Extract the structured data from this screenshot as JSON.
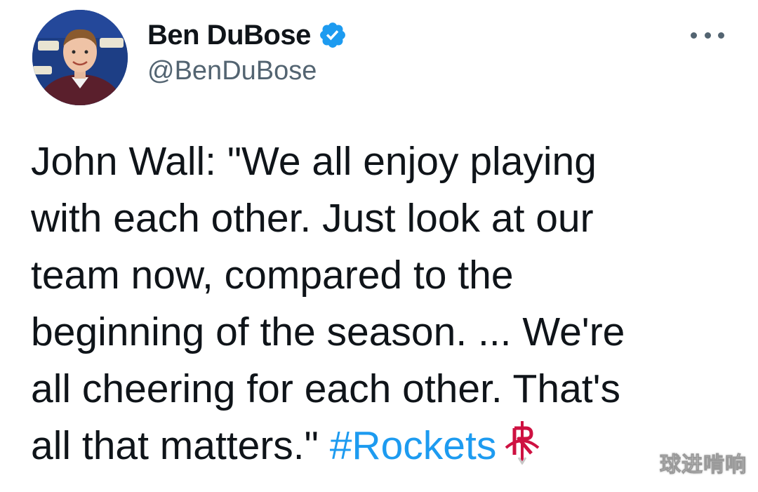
{
  "author": {
    "display_name": "Ben DuBose",
    "handle": "@BenDuBose",
    "verified": true,
    "avatar_icon": "profile-photo"
  },
  "menu": {
    "icon": "more-options-icon"
  },
  "tweet": {
    "lines": [
      "John Wall: \"We all enjoy playing",
      "with each other. Just look at our",
      "team now, compared to the",
      "beginning of the season. ... We're",
      "all cheering for each other. That's",
      "all that matters.\" "
    ],
    "hashtag": "#Rockets",
    "hashtag_emoji_icon": "houston-rockets-logo-icon"
  },
  "watermark": {
    "text": "球进啃响"
  },
  "colors": {
    "text": "#0f1419",
    "secondary": "#536471",
    "link": "#1d9bf0",
    "verified": "#1d9bf0",
    "rockets_red": "#ce1141"
  }
}
